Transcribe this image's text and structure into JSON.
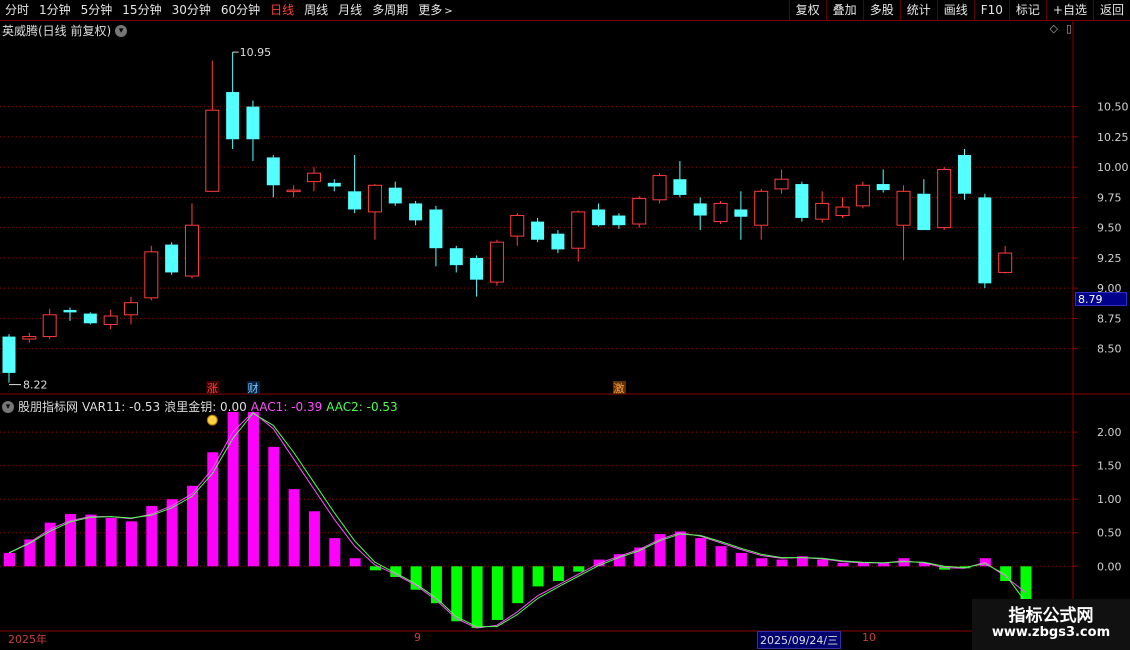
{
  "toolbar": {
    "periods": [
      "分时",
      "1分钟",
      "5分钟",
      "15分钟",
      "30分钟",
      "60分钟",
      "日线",
      "周线",
      "月线",
      "多周期",
      "更多"
    ],
    "active": "日线",
    "right_buttons": [
      "复权",
      "叠加",
      "多股",
      "统计",
      "画线",
      "F10",
      "标记",
      "+自选",
      "返回"
    ]
  },
  "title": "英威腾(日线 前复权)",
  "price_axis": {
    "ticks": [
      "10.50",
      "10.25",
      "10.00",
      "9.75",
      "9.50",
      "9.25",
      "9.00",
      "8.75",
      "8.50"
    ],
    "current": "8.79"
  },
  "annotations": {
    "high": "10.95",
    "low": "8.22",
    "tag_zhang": "涨",
    "tag_cai": "财",
    "tag_ji": "激"
  },
  "indicator": {
    "name": "股朋指标网",
    "var11_label": "VAR11: -0.53",
    "lang_label": "浪里金钥: 0.00",
    "aac1_label": "AAC1: -0.39",
    "aac2_label": "AAC2: -0.53",
    "ticks": [
      "2.00",
      "1.50",
      "1.00",
      "0.50",
      "0.00"
    ]
  },
  "xaxis": {
    "year": "2025年",
    "m9": "9",
    "date": "2025/09/24/三",
    "m10": "10"
  },
  "watermark": {
    "line1": "指标公式网",
    "line2": "www.zbgs3.com"
  },
  "colors": {
    "up": "#ff3c3c",
    "down": "#54ffff",
    "pos_bar": "#ff00ff",
    "neg_bar": "#00ff00",
    "aac1": "#ff50ff",
    "aac2": "#50ff50",
    "grid": "#8b0000"
  },
  "chart_data": {
    "type": "candlestick",
    "ylim": [
      8.2,
      11.05
    ],
    "candles": [
      [
        8.6,
        8.3,
        8.62,
        8.22
      ],
      [
        8.58,
        8.6,
        8.63,
        8.55
      ],
      [
        8.6,
        8.78,
        8.83,
        8.58
      ],
      [
        8.82,
        8.8,
        8.84,
        8.73
      ],
      [
        8.79,
        8.71,
        8.8,
        8.7
      ],
      [
        8.7,
        8.77,
        8.82,
        8.66
      ],
      [
        8.78,
        8.88,
        8.93,
        8.7
      ],
      [
        8.92,
        9.3,
        9.35,
        8.9
      ],
      [
        9.36,
        9.13,
        9.38,
        9.11
      ],
      [
        9.1,
        9.52,
        9.7,
        9.08
      ],
      [
        9.8,
        10.47,
        10.88,
        9.8
      ],
      [
        10.62,
        10.23,
        10.95,
        10.15
      ],
      [
        10.5,
        10.23,
        10.55,
        10.05
      ],
      [
        10.08,
        9.85,
        10.1,
        9.75
      ],
      [
        9.8,
        9.81,
        9.85,
        9.75
      ],
      [
        9.88,
        9.95,
        10.0,
        9.8
      ],
      [
        9.87,
        9.84,
        9.9,
        9.8
      ],
      [
        9.8,
        9.65,
        10.1,
        9.62
      ],
      [
        9.63,
        9.85,
        9.86,
        9.4
      ],
      [
        9.83,
        9.7,
        9.88,
        9.68
      ],
      [
        9.7,
        9.56,
        9.72,
        9.52
      ],
      [
        9.65,
        9.33,
        9.68,
        9.18
      ],
      [
        9.33,
        9.19,
        9.35,
        9.13
      ],
      [
        9.25,
        9.07,
        9.27,
        8.93
      ],
      [
        9.05,
        9.38,
        9.4,
        9.02
      ],
      [
        9.43,
        9.6,
        9.62,
        9.35
      ],
      [
        9.55,
        9.4,
        9.58,
        9.38
      ],
      [
        9.45,
        9.32,
        9.48,
        9.29
      ],
      [
        9.33,
        9.63,
        9.64,
        9.22
      ],
      [
        9.65,
        9.52,
        9.7,
        9.51
      ],
      [
        9.6,
        9.52,
        9.62,
        9.49
      ],
      [
        9.53,
        9.74,
        9.76,
        9.5
      ],
      [
        9.73,
        9.93,
        9.95,
        9.7
      ],
      [
        9.9,
        9.77,
        10.05,
        9.75
      ],
      [
        9.7,
        9.6,
        9.75,
        9.48
      ],
      [
        9.55,
        9.7,
        9.72,
        9.53
      ],
      [
        9.65,
        9.59,
        9.8,
        9.4
      ],
      [
        9.52,
        9.8,
        9.82,
        9.4
      ],
      [
        9.82,
        9.9,
        9.98,
        9.78
      ],
      [
        9.86,
        9.58,
        9.88,
        9.55
      ],
      [
        9.57,
        9.7,
        9.8,
        9.54
      ],
      [
        9.6,
        9.67,
        9.75,
        9.58
      ],
      [
        9.68,
        9.85,
        9.88,
        9.66
      ],
      [
        9.86,
        9.81,
        9.98,
        9.79
      ],
      [
        9.52,
        9.8,
        9.85,
        9.23
      ],
      [
        9.78,
        9.48,
        9.9,
        9.48
      ],
      [
        9.5,
        9.98,
        10.0,
        9.48
      ],
      [
        10.1,
        9.78,
        10.15,
        9.73
      ],
      [
        9.75,
        9.04,
        9.78,
        9.0
      ],
      [
        9.13,
        9.29,
        9.35,
        9.12
      ]
    ],
    "indicator_bars": [
      0.2,
      0.4,
      0.65,
      0.78,
      0.77,
      0.72,
      0.67,
      0.9,
      1.0,
      1.2,
      1.7,
      2.3,
      2.3,
      1.78,
      1.15,
      0.82,
      0.42,
      0.12,
      -0.06,
      -0.16,
      -0.35,
      -0.55,
      -0.82,
      -0.92,
      -0.8,
      -0.55,
      -0.3,
      -0.22,
      -0.08,
      0.1,
      0.18,
      0.28,
      0.48,
      0.52,
      0.42,
      0.3,
      0.2,
      0.12,
      0.1,
      0.15,
      0.1,
      0.05,
      0.05,
      0.05,
      0.12,
      0.05,
      -0.05,
      -0.03,
      0.12,
      -0.22,
      -0.53
    ],
    "aac1": [
      0.2,
      0.35,
      0.55,
      0.68,
      0.74,
      0.74,
      0.71,
      0.78,
      0.9,
      1.08,
      1.45,
      2.0,
      2.3,
      2.05,
      1.6,
      1.15,
      0.7,
      0.3,
      0.02,
      -0.12,
      -0.28,
      -0.5,
      -0.78,
      -0.92,
      -0.88,
      -0.68,
      -0.44,
      -0.28,
      -0.12,
      0.04,
      0.15,
      0.25,
      0.4,
      0.5,
      0.45,
      0.35,
      0.25,
      0.16,
      0.12,
      0.13,
      0.11,
      0.07,
      0.05,
      0.05,
      0.08,
      0.05,
      -0.02,
      -0.03,
      0.06,
      -0.15,
      -0.39
    ],
    "aac2": [
      0.2,
      0.34,
      0.52,
      0.66,
      0.73,
      0.74,
      0.72,
      0.76,
      0.87,
      1.04,
      1.38,
      1.9,
      2.28,
      2.1,
      1.7,
      1.25,
      0.8,
      0.38,
      0.06,
      -0.1,
      -0.26,
      -0.47,
      -0.75,
      -0.9,
      -0.9,
      -0.72,
      -0.48,
      -0.31,
      -0.15,
      0.01,
      0.13,
      0.23,
      0.38,
      0.48,
      0.46,
      0.37,
      0.27,
      0.18,
      0.13,
      0.13,
      0.12,
      0.08,
      0.06,
      0.05,
      0.07,
      0.06,
      0.0,
      -0.02,
      0.04,
      -0.12,
      -0.53
    ],
    "indicator_ylim": [
      -0.92,
      2.3
    ]
  }
}
